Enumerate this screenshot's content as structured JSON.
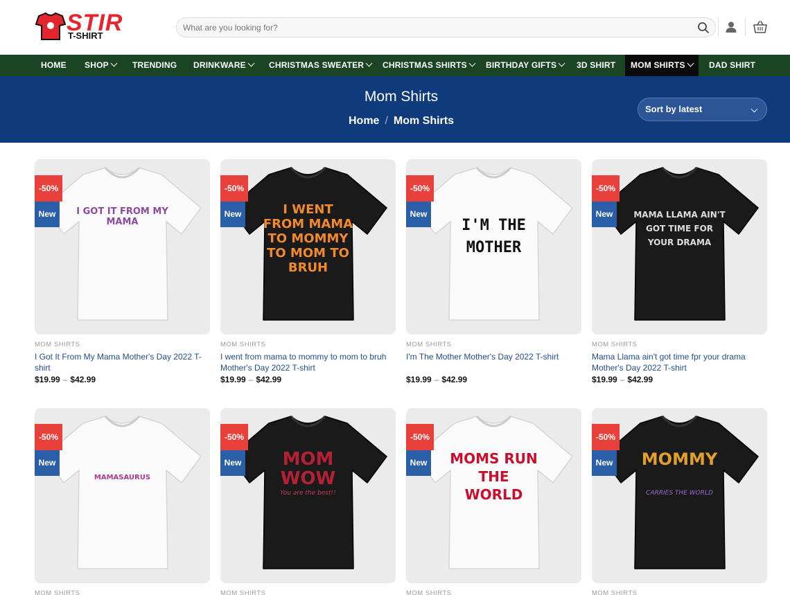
{
  "brand": {
    "logo_text": "STIR",
    "logo_sub": "T-SHIRT",
    "accent": "#e3262e"
  },
  "search": {
    "placeholder": "What are you looking for?"
  },
  "header_icons": [
    "search-icon",
    "user-icon",
    "cart-icon"
  ],
  "nav": {
    "items": [
      {
        "label": "HOME"
      },
      {
        "label": "SHOP"
      },
      {
        "label": "TRENDING"
      },
      {
        "label": "DRINKWARE"
      },
      {
        "label": "CHRISTMAS SWEATER"
      },
      {
        "label": "CHRISTMAS SHIRTS"
      },
      {
        "label": "BIRTHDAY GIFTS"
      },
      {
        "label": "3D SHIRT"
      },
      {
        "label": "MOM SHIRTS"
      },
      {
        "label": "DAD SHIRT"
      }
    ],
    "background": "#1a4424",
    "active_background": "#0b0b0b"
  },
  "banner": {
    "title": "Mom Shirts",
    "breadcrumb_home": "Home",
    "breadcrumb_sep": "/",
    "breadcrumb_current": "Mom Shirts",
    "sort_label": "Sort by latest",
    "background": "#0f3b7d"
  },
  "badges": {
    "sale": "-50%",
    "new": "New"
  },
  "products": [
    {
      "category": "MOM SHIRTS",
      "title": "I Got It From My Mama Mother's Day 2022 T-shirt",
      "price_low": "$19.99",
      "price_high": "$42.99",
      "shirt_color": "white",
      "print_text": "I GOT IT FROM MY MAMA"
    },
    {
      "category": "MOM SHIRTS",
      "title": "I went from mama to mommy to mom to bruh Mother's Day 2022 T-shirt",
      "price_low": "$19.99",
      "price_high": "$42.99",
      "shirt_color": "black",
      "print_text": "I WENT FROM MAMA TO MOMMY TO MOM TO BRUH"
    },
    {
      "category": "MOM SHIRTS",
      "title": "I'm The Mother Mother's Day 2022 T-shirt",
      "price_low": "$19.99",
      "price_high": "$42.99",
      "shirt_color": "white",
      "print_text": "I'M THE MOTHER"
    },
    {
      "category": "MOM SHIRTS",
      "title": "Mama Llama ain't got time fpr your drama Mother's Day 2022 T-shirt",
      "price_low": "$19.99",
      "price_high": "$42.99",
      "shirt_color": "black",
      "print_text": "MAMA LLAMA AIN'T GOT TIME FOR YOUR DRAMA"
    },
    {
      "category": "MOM SHIRTS",
      "title": "",
      "price_low": "",
      "price_high": "",
      "shirt_color": "white",
      "print_text": "MAMASAURUS"
    },
    {
      "category": "MOM SHIRTS",
      "title": "",
      "price_low": "",
      "price_high": "",
      "shirt_color": "black",
      "print_text": "MOM WOW",
      "print_sub": "You are the best!!"
    },
    {
      "category": "MOM SHIRTS",
      "title": "",
      "price_low": "",
      "price_high": "",
      "shirt_color": "white",
      "print_text": "MOMS RUN THE WORLD"
    },
    {
      "category": "MOM SHIRTS",
      "title": "",
      "price_low": "",
      "price_high": "",
      "shirt_color": "black",
      "print_text": "MOMMY",
      "print_sub": "CARRIES THE WORLD"
    }
  ]
}
